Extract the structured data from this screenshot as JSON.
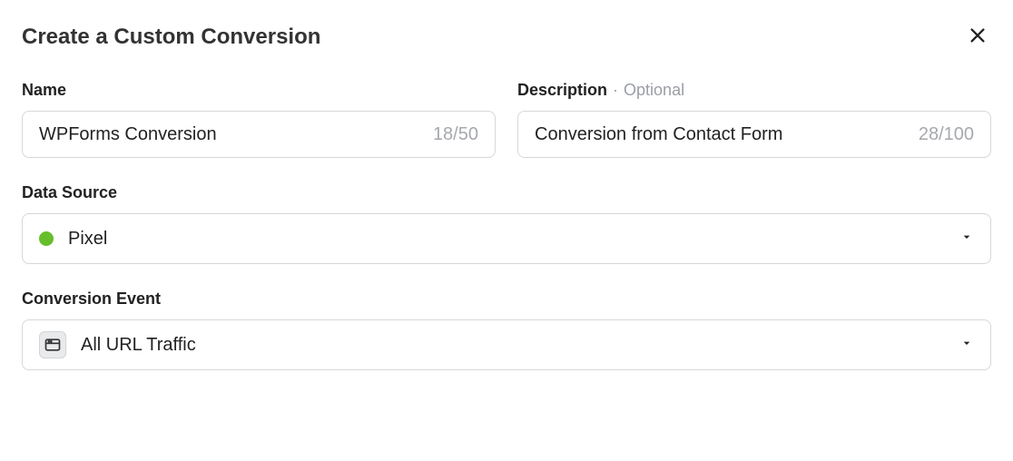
{
  "header": {
    "title": "Create a Custom Conversion"
  },
  "name_field": {
    "label": "Name",
    "value": "WPForms Conversion",
    "counter": "18/50"
  },
  "description_field": {
    "label": "Description",
    "optional": "Optional",
    "value": "Conversion from Contact Form",
    "counter": "28/100"
  },
  "data_source": {
    "label": "Data Source",
    "status_color": "#66be2b",
    "value": "Pixel"
  },
  "conversion_event": {
    "label": "Conversion Event",
    "value": "All URL Traffic"
  }
}
